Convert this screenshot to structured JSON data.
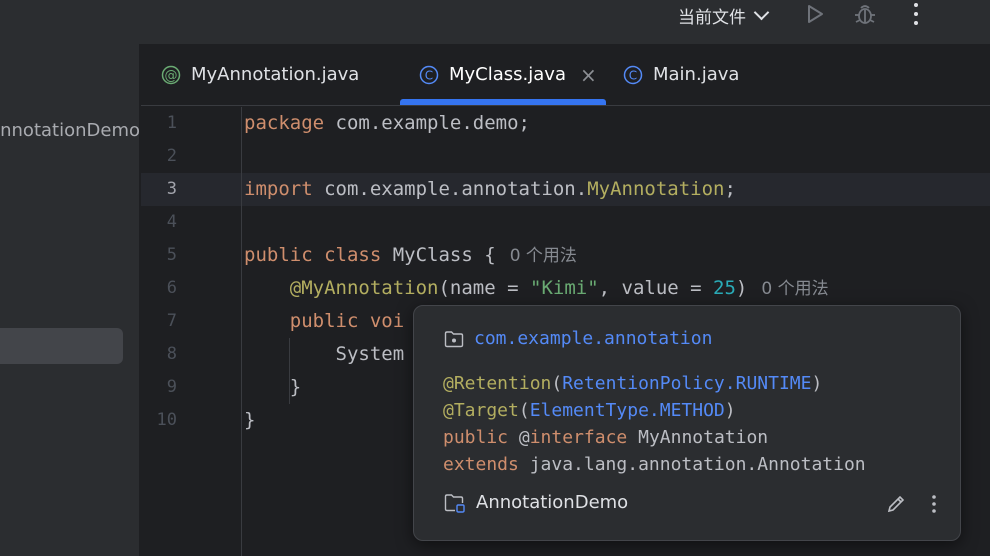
{
  "titlebar": {
    "run_config": "当前文件"
  },
  "sidebar": {
    "project_name": "AnnotationDemo"
  },
  "tabs": [
    {
      "label": "MyAnnotation.java",
      "icon": "annotation-icon"
    },
    {
      "label": "MyClass.java",
      "icon": "class-icon",
      "active": true
    },
    {
      "label": "Main.java",
      "icon": "class-icon"
    }
  ],
  "tab_close": "×",
  "editor": {
    "line_numbers": [
      "1",
      "2",
      "3",
      "4",
      "5",
      "6",
      "7",
      "8",
      "9",
      "10"
    ],
    "current_line": 3,
    "line1": {
      "kw": "package",
      "rest": " com.example.demo;"
    },
    "line3": {
      "kw": "import",
      "mid": " com.example.annotation.",
      "cls": "MyAnnotation",
      "end": ";"
    },
    "line5": {
      "kw1": "public",
      "kw2": "class",
      "name": " MyClass {",
      "hint": "0 个用法"
    },
    "line6": {
      "ann": "@MyAnnotation",
      "p1": "(name = ",
      "str": "\"Kimi\"",
      "p2": ", value = ",
      "num": "25",
      "p3": ")",
      "hint": "0 个用法"
    },
    "line7": {
      "kw": "public",
      "rest": " voi"
    },
    "line8": {
      "text": "System"
    },
    "line9": {
      "text": "}"
    },
    "line10": {
      "text": "}"
    }
  },
  "popup": {
    "package": "com.example.annotation",
    "retention": {
      "ann": "@Retention",
      "open": "(",
      "value": "RetentionPolicy.RUNTIME",
      "close": ")"
    },
    "target": {
      "ann": "@Target",
      "open": "(",
      "value": "ElementType.METHOD",
      "close": ")"
    },
    "decl": {
      "kw": "public",
      "at": " @",
      "kw2": "interface",
      "name": " MyAnnotation"
    },
    "extends": {
      "kw": "extends",
      "name": " java.lang.annotation.Annotation"
    },
    "module": "AnnotationDemo"
  },
  "colors": {
    "accent": "#3574f0",
    "link": "#548af7",
    "keyword": "#cf8e6d",
    "annotation": "#b3ae60",
    "string": "#6aab73",
    "number": "#2aacb8"
  }
}
